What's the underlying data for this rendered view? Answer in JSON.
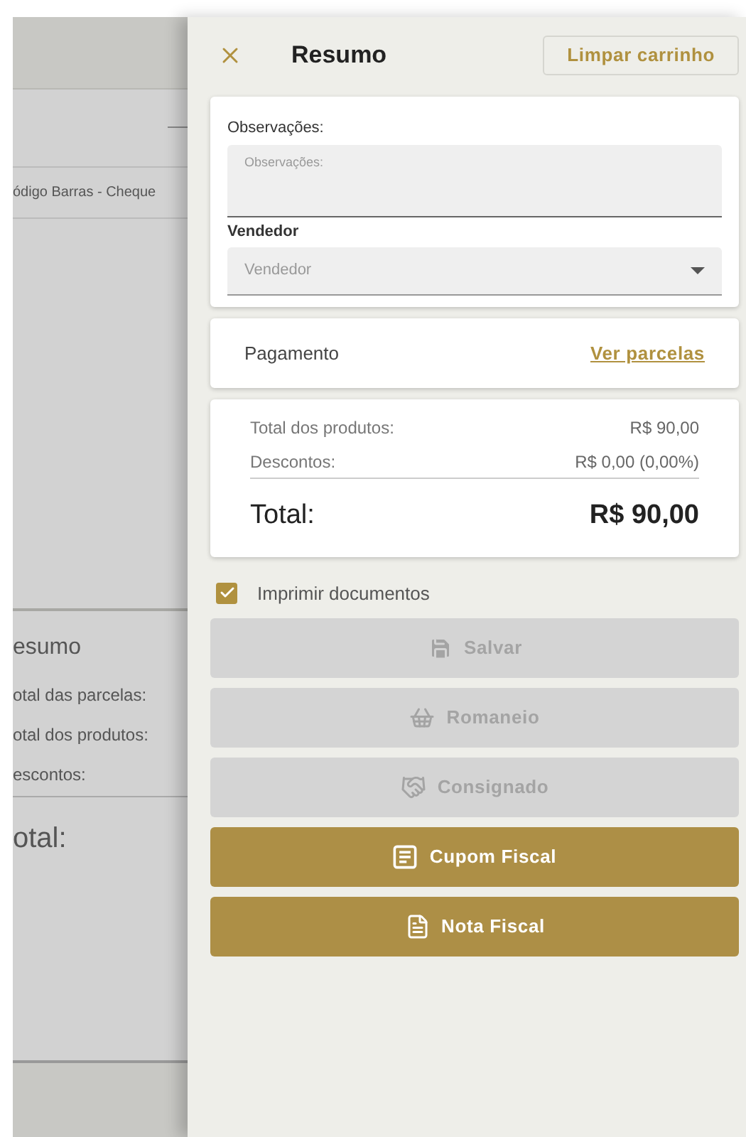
{
  "background_page": {
    "table_header": "ódigo Barras - Cheque",
    "summary_title": "esumo",
    "summary_rows": [
      "otal das parcelas:",
      "otal dos produtos:",
      "escontos:"
    ],
    "total_label": "otal:"
  },
  "drawer": {
    "title": "Resumo",
    "clear_button": "Limpar carrinho",
    "notes": {
      "label": "Observações:",
      "placeholder": "Observações:"
    },
    "seller": {
      "label": "Vendedor",
      "placeholder": "Vendedor"
    },
    "payment": {
      "label": "Pagamento",
      "link": "Ver parcelas"
    },
    "totals": {
      "rows": [
        {
          "label": "Total dos produtos:",
          "value": "R$ 90,00"
        },
        {
          "label": "Descontos:",
          "value": "R$ 0,00 (0,00%)"
        }
      ],
      "total_label": "Total:",
      "total_value": "R$ 90,00"
    },
    "print_documents": {
      "label": "Imprimir documentos",
      "checked": true
    },
    "actions": [
      {
        "label": "Salvar",
        "disabled": true
      },
      {
        "label": "Romaneio",
        "disabled": true
      },
      {
        "label": "Consignado",
        "disabled": true
      },
      {
        "label": "Cupom Fiscal",
        "disabled": false
      },
      {
        "label": "Nota Fiscal",
        "disabled": false
      }
    ]
  }
}
